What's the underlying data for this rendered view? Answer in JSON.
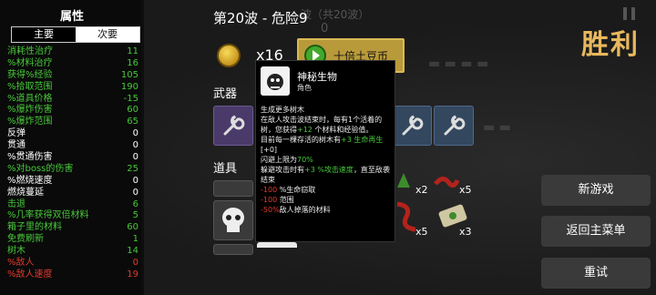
{
  "stats_panel": {
    "title": "属性",
    "tabs": [
      {
        "label": "主要",
        "active": true
      },
      {
        "label": "次要",
        "active": false
      }
    ],
    "rows": [
      {
        "label": "消耗性治疗",
        "value": "11",
        "color": "#48c83a"
      },
      {
        "label": "%材料治疗",
        "value": "16",
        "color": "#48c83a"
      },
      {
        "label": "获得%经验",
        "value": "105",
        "color": "#48c83a"
      },
      {
        "label": "%拾取范围",
        "value": "190",
        "color": "#48c83a"
      },
      {
        "label": "%道具价格",
        "value": "-15",
        "color": "#48c83a"
      },
      {
        "label": "%爆炸伤害",
        "value": "60",
        "color": "#48c83a"
      },
      {
        "label": "%爆炸范围",
        "value": "65",
        "color": "#48c83a"
      },
      {
        "label": "反弹",
        "value": "0",
        "color": "#ffffff"
      },
      {
        "label": "贯通",
        "value": "0",
        "color": "#ffffff"
      },
      {
        "label": "%贯通伤害",
        "value": "0",
        "color": "#ffffff"
      },
      {
        "label": "%对boss的伤害",
        "value": "25",
        "color": "#48c83a"
      },
      {
        "label": "%燃烧速度",
        "value": "0",
        "color": "#ffffff"
      },
      {
        "label": "燃烧蔓延",
        "value": "0",
        "color": "#ffffff"
      },
      {
        "label": "击退",
        "value": "6",
        "color": "#48c83a"
      },
      {
        "label": "%几率获得双倍材料",
        "value": "5",
        "color": "#48c83a"
      },
      {
        "label": "箱子里的材料",
        "value": "60",
        "color": "#48c83a"
      },
      {
        "label": "免费刷新",
        "value": "1",
        "color": "#48c83a"
      },
      {
        "label": "树木",
        "value": "14",
        "color": "#48c83a"
      },
      {
        "label": "%敌人",
        "value": "0",
        "color": "#e03a2e"
      },
      {
        "label": "%敌人速度",
        "value": "19",
        "color": "#e03a2e"
      }
    ]
  },
  "header": {
    "wave_title": "第20波 - 危险9",
    "wave_ghost": "波（共20波）",
    "wave_ghost_num": "0"
  },
  "coins": {
    "count": "x16"
  },
  "reroll_button": {
    "label": "十倍土豆币"
  },
  "sections": {
    "weapons": "武器",
    "items": "道具"
  },
  "item_counts": [
    "x2",
    "x5",
    "x5",
    "x3"
  ],
  "tooltip": {
    "name": "神秘生物",
    "type": "角色",
    "lines": [
      {
        "text": "生成更多树木",
        "cls": ""
      },
      {
        "text": "在敌人攻击波结束时，每有1个活着的树，您获得",
        "cls": ""
      },
      {
        "text": "+12",
        "cls": "g"
      },
      {
        "text": " 个材料和经验值。",
        "cls": ""
      },
      {
        "text": "目前每一棵存活的树木有",
        "cls": ""
      },
      {
        "text": "+3 生命再生",
        "cls": "g"
      },
      {
        "text": "[+0]",
        "cls": ""
      },
      {
        "text": "闪避上限为",
        "cls": ""
      },
      {
        "text": "70%",
        "cls": "g"
      },
      {
        "text": "躲避攻击时有",
        "cls": ""
      },
      {
        "text": "+3 %攻击速度",
        "cls": "g"
      },
      {
        "text": "，直至敌袭结束",
        "cls": ""
      },
      {
        "text": "-100",
        "cls": "r"
      },
      {
        "text": " %生命窃取",
        "cls": ""
      },
      {
        "text": "-100",
        "cls": "r"
      },
      {
        "text": " 范围",
        "cls": ""
      },
      {
        "text": "-50%",
        "cls": "r"
      },
      {
        "text": "敌人掉落的材料",
        "cls": ""
      }
    ]
  },
  "victory": "胜利",
  "menu": {
    "new_game": "新游戏",
    "main_menu": "返回主菜单",
    "retry": "重试"
  },
  "colors": {
    "accent_gold": "#e8b85e",
    "positive": "#48c83a",
    "negative": "#e03a2e"
  }
}
